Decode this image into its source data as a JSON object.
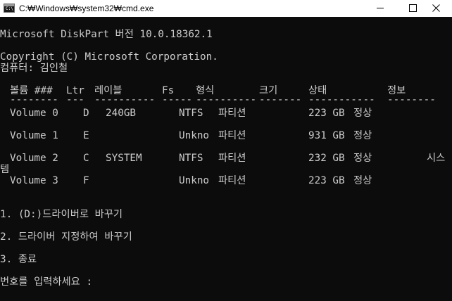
{
  "window": {
    "icon_label": "C:\\",
    "title": "C:₩Windows₩system32₩cmd.exe",
    "minimize_label": "",
    "maximize_label": "",
    "close_label": ""
  },
  "console": {
    "header_line": "Microsoft DiskPart 버전 10.0.18362.1",
    "copyright_line": "Copyright (C) Microsoft Corporation.",
    "computer_line": "컴퓨터: 김인철",
    "table": {
      "headers": [
        "볼륨 ###",
        "Ltr",
        "레이블",
        "Fs",
        "형식",
        "크기",
        "상태",
        "정보"
      ],
      "dashes": [
        "--------",
        "---",
        "----------",
        "-----",
        "----------",
        "-------",
        "-----------",
        "--------"
      ],
      "rows": [
        [
          "Volume 0",
          "D",
          "240GB",
          "NTFS",
          "파티션",
          "223 GB",
          "정상",
          ""
        ],
        [
          "Volume 1",
          "E",
          "",
          "Unkno",
          "파티션",
          "931 GB",
          "정상",
          ""
        ],
        [
          "Volume 2",
          "C",
          "SYSTEM",
          "NTFS",
          "파티션",
          "232 GB",
          "정상",
          "시스"
        ],
        [
          "Volume 3",
          "F",
          "",
          "Unkno",
          "파티션",
          "223 GB",
          "정상",
          ""
        ]
      ],
      "wrap_text": "템"
    },
    "menu": [
      "1. (D:)드라이버로 바꾸기",
      "2. 드라이버 지정하여 바꾸기",
      "3. 종료"
    ],
    "prompt": "번호를 입력하세요 :"
  }
}
